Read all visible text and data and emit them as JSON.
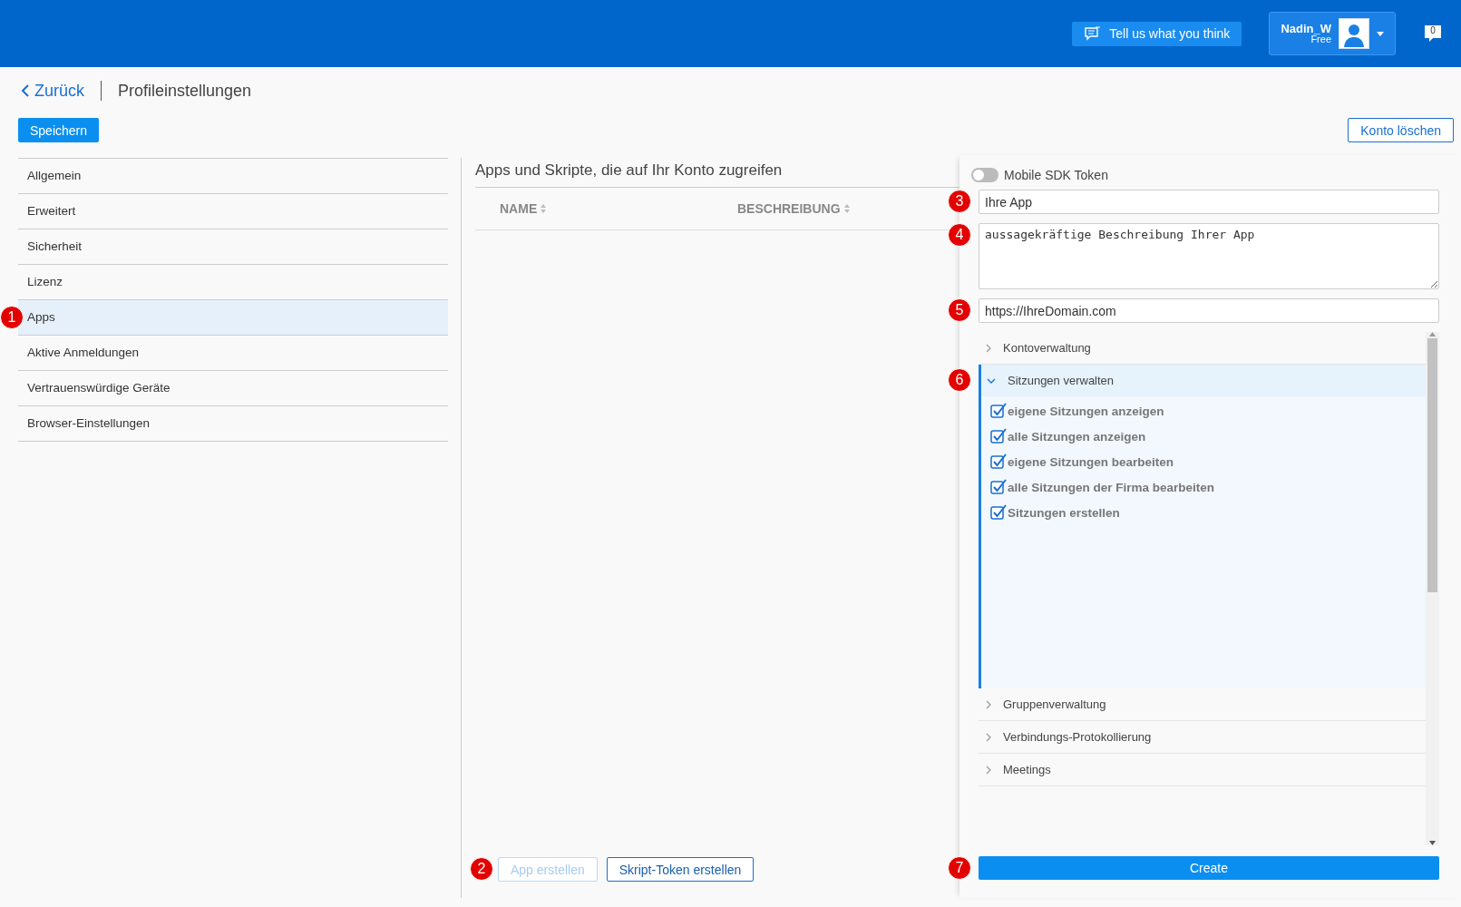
{
  "header": {
    "feedback_button": "Tell us what you think",
    "user": {
      "name": "Nadin_W",
      "plan": "Free"
    },
    "notifications": "0"
  },
  "nav": {
    "back": "Zurück",
    "title": "Profileinstellungen"
  },
  "save_button": "Speichern",
  "delete_button": "Konto löschen",
  "sidebar": {
    "items": [
      {
        "label": "Allgemein",
        "selected": false
      },
      {
        "label": "Erweitert",
        "selected": false
      },
      {
        "label": "Sicherheit",
        "selected": false
      },
      {
        "label": "Lizenz",
        "selected": false
      },
      {
        "label": "Apps",
        "selected": true,
        "marker": "1"
      },
      {
        "label": "Aktive Anmeldungen",
        "selected": false
      },
      {
        "label": "Vertrauenswürdige Geräte",
        "selected": false
      },
      {
        "label": "Browser-Einstellungen",
        "selected": false
      }
    ]
  },
  "apps": {
    "heading": "Apps und Skripte, die auf Ihr Konto zugreifen",
    "columns": [
      "NAME",
      "BESCHREIBUNG"
    ],
    "buttons_marker": "2",
    "buttons": [
      {
        "label": "App erstellen",
        "disabled": true
      },
      {
        "label": "Skript-Token erstellen",
        "disabled": false
      }
    ]
  },
  "form": {
    "mobile_sdk": {
      "label": "Mobile SDK Token",
      "on": false
    },
    "name_field": {
      "value": "Ihre App",
      "marker": "3"
    },
    "description_field": {
      "value": "aussagekräftige Beschreibung Ihrer App",
      "marker": "4"
    },
    "url_field": {
      "value": "https://IhreDomain.com",
      "marker": "5"
    },
    "scopes": [
      {
        "label": "Kontoverwaltung",
        "expanded": false
      },
      {
        "label": "Sitzungen verwalten",
        "expanded": true,
        "marker": "6",
        "children": [
          {
            "label": "eigene Sitzungen anzeigen",
            "checked": true
          },
          {
            "label": "alle Sitzungen anzeigen",
            "checked": true
          },
          {
            "label": "eigene Sitzungen bearbeiten",
            "checked": true
          },
          {
            "label": "alle Sitzungen der Firma bearbeiten",
            "checked": true
          },
          {
            "label": "Sitzungen erstellen",
            "checked": true
          }
        ]
      },
      {
        "label": "Gruppenverwaltung",
        "expanded": false
      },
      {
        "label": "Verbindungs-Protokollierung",
        "expanded": false
      },
      {
        "label": "Meetings",
        "expanded": false
      }
    ],
    "create_button": {
      "label": "Create",
      "marker": "7"
    }
  }
}
